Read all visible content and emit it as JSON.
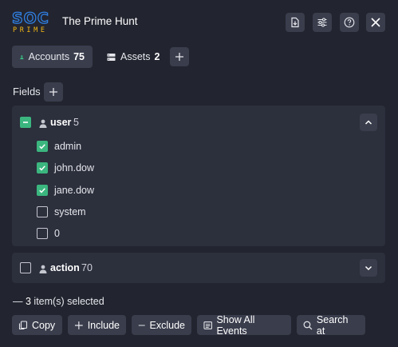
{
  "header": {
    "logo_top": "SOC",
    "logo_bottom": "PRIME",
    "title": "The Prime Hunt"
  },
  "tabs": [
    {
      "label": "Accounts",
      "count": "75",
      "active": true
    },
    {
      "label": "Assets",
      "count": "2",
      "active": false
    }
  ],
  "fields": {
    "label": "Fields"
  },
  "groups": {
    "user": {
      "name": "user",
      "count": "5",
      "expanded": true,
      "items": [
        {
          "label": "admin",
          "checked": true
        },
        {
          "label": "john.dow",
          "checked": true
        },
        {
          "label": "jane.dow",
          "checked": true
        },
        {
          "label": "system",
          "checked": false
        },
        {
          "label": "0",
          "checked": false
        }
      ]
    },
    "action": {
      "name": "action",
      "count": "70",
      "expanded": false
    }
  },
  "selection": {
    "dash": "—",
    "count": "3",
    "unit": "item(s)",
    "suffix": "selected"
  },
  "actions": {
    "copy": "Copy",
    "include": "Include",
    "exclude": "Exclude",
    "show_all": "Show All Events",
    "search_at": "Search at"
  },
  "colors": {
    "background": "#22242f",
    "panel": "#2c2f3c",
    "button": "#3a3d4c",
    "accent_green": "#3bb67f",
    "logo_blue": "#2f7fe0",
    "logo_yellow": "#f5b915"
  }
}
